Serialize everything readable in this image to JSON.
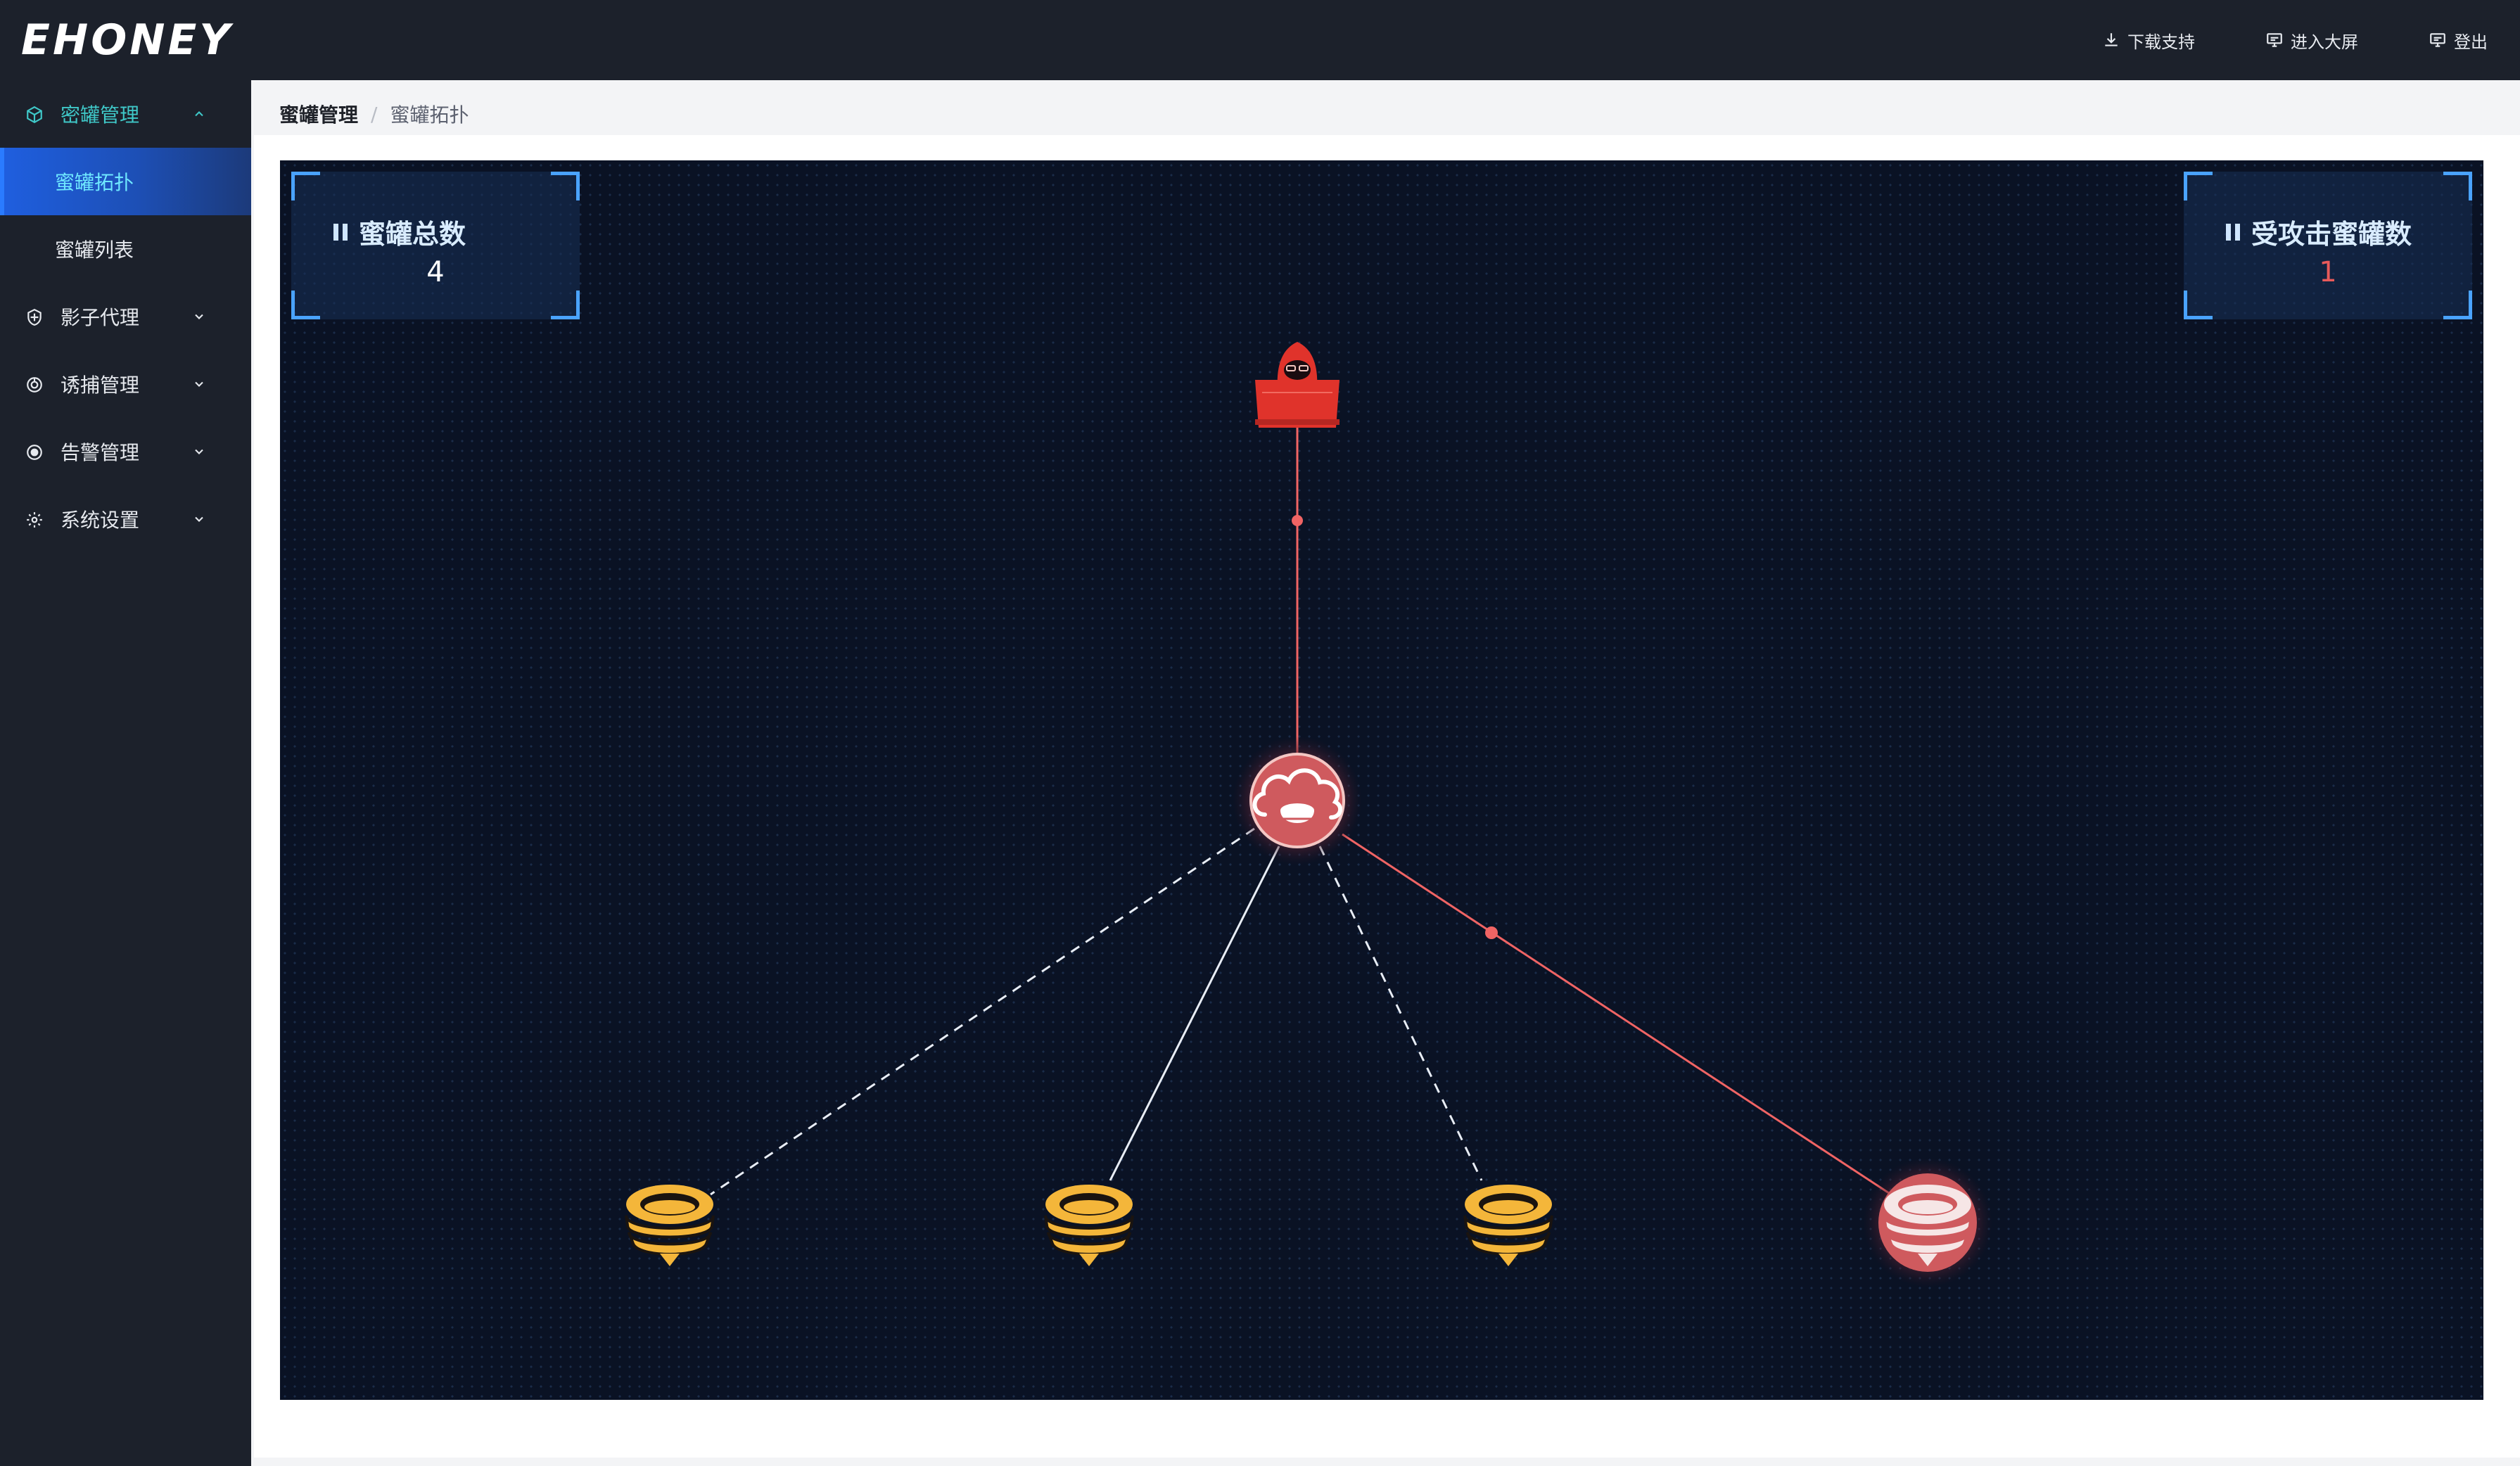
{
  "brand": {
    "logo_text": "EHONEY"
  },
  "topnav": [
    {
      "label": "下载支持",
      "icon": "download-icon"
    },
    {
      "label": "进入大屏",
      "icon": "monitor-icon"
    },
    {
      "label": "登出",
      "icon": "logout-icon"
    }
  ],
  "sidebar": {
    "groups": [
      {
        "label": "密罐管理",
        "icon": "cube-icon",
        "open": true,
        "children": [
          {
            "label": "蜜罐拓扑",
            "active": true
          },
          {
            "label": "蜜罐列表",
            "active": false
          }
        ]
      },
      {
        "label": "影子代理",
        "icon": "shield-icon",
        "open": false
      },
      {
        "label": "诱捕管理",
        "icon": "trap-icon",
        "open": false
      },
      {
        "label": "告警管理",
        "icon": "alarm-icon",
        "open": false
      },
      {
        "label": "系统设置",
        "icon": "gear-icon",
        "open": false
      }
    ]
  },
  "breadcrumb": {
    "parent": "蜜罐管理",
    "separator": "/",
    "current": "蜜罐拓扑"
  },
  "stats": {
    "total": {
      "label": "蜜罐总数",
      "value": "4",
      "color": "#ffffff"
    },
    "attacked": {
      "label": "受攻击蜜罐数",
      "value": "1",
      "color": "#e85a5a"
    }
  },
  "topology": {
    "attacker": {
      "type": "hacker",
      "color": "#e0332b"
    },
    "hub": {
      "type": "cloud-honeypot",
      "attacked": true
    },
    "honeypots": [
      {
        "id": 1,
        "attacked": false,
        "link": "dashed"
      },
      {
        "id": 2,
        "attacked": false,
        "link": "solid"
      },
      {
        "id": 3,
        "attacked": false,
        "link": "dashed"
      },
      {
        "id": 4,
        "attacked": true,
        "link": "attack"
      }
    ],
    "colors": {
      "normal": "#f4b63a",
      "attacked": "#d9545a",
      "link": "#e8edf5",
      "attack_link": "#f06464"
    }
  }
}
